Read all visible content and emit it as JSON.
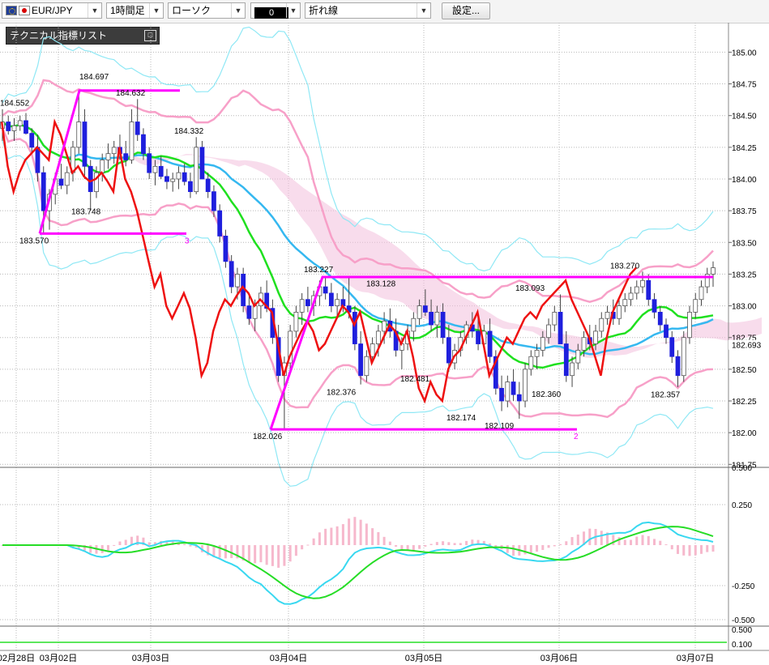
{
  "toolbar": {
    "symbol": "EUR/JPY",
    "timeframe": "1時間足",
    "chart_type": "ローソク",
    "drawing_tool": "0",
    "line_type": "折れ線",
    "settings_button": "設定..."
  },
  "indicator_panel": {
    "title": "テクニカル指標リスト",
    "collapse_icon": "□"
  },
  "colors": {
    "bull": "#ffffff",
    "bear": "#1f1fdd",
    "wick": "#444444",
    "ma_short": "#1fe01f",
    "ma_mid": "#35b8f0",
    "bb_outer": "#8fe8f5",
    "bb_inner": "#f7a0c8",
    "zigzag": "#ff00ff",
    "red_line": "#ee1111",
    "cloud": "#f2bfdc",
    "cloud_blue": "#b8d8f5"
  },
  "chart_data": [
    {
      "type": "candlestick",
      "title": "",
      "price_axis": {
        "ticks": [
          "185.00",
          "184.75",
          "184.50",
          "184.25",
          "184.00",
          "183.75",
          "183.50",
          "183.25",
          "183.00",
          "182.75",
          "182.50",
          "182.25",
          "182.00",
          "181.75"
        ],
        "ylim": [
          181.72,
          185.06
        ],
        "current_price": "182.693"
      },
      "date_labels": [
        "02月28日",
        "03月02日",
        "03月03日",
        "03月04日",
        "03月05日",
        "03月06日",
        "03月07日"
      ],
      "annotations": [
        "184.552",
        "184.697",
        "184.632",
        "184.332",
        "183.748",
        "183.570",
        "183.227",
        "183.128",
        "183.093",
        "183.270",
        "182.376",
        "182.481",
        "182.174",
        "182.109",
        "182.360",
        "182.357",
        "182.026"
      ],
      "zigzag_markers": [
        "3",
        "2"
      ],
      "candles_ohlc": [
        [
          184.4,
          184.55,
          184.3,
          184.45
        ],
        [
          184.45,
          184.5,
          184.35,
          184.38
        ],
        [
          184.38,
          184.48,
          184.3,
          184.42
        ],
        [
          184.42,
          184.5,
          184.38,
          184.46
        ],
        [
          184.46,
          184.52,
          184.35,
          184.36
        ],
        [
          184.36,
          184.4,
          184.2,
          184.25
        ],
        [
          184.25,
          184.35,
          183.98,
          184.05
        ],
        [
          184.05,
          184.1,
          183.57,
          183.75
        ],
        [
          183.75,
          183.92,
          183.6,
          183.88
        ],
        [
          183.88,
          184.05,
          183.8,
          184.0
        ],
        [
          184.0,
          184.12,
          183.92,
          183.95
        ],
        [
          183.95,
          184.1,
          183.88,
          184.05
        ],
        [
          184.05,
          184.3,
          183.98,
          184.25
        ],
        [
          184.25,
          184.69,
          184.2,
          184.45
        ],
        [
          184.45,
          184.55,
          184.0,
          184.1
        ],
        [
          184.1,
          184.15,
          183.75,
          183.9
        ],
        [
          183.9,
          184.1,
          183.85,
          184.05
        ],
        [
          184.05,
          184.2,
          183.98,
          184.15
        ],
        [
          184.15,
          184.28,
          184.08,
          184.2
        ],
        [
          184.2,
          184.3,
          184.12,
          184.25
        ],
        [
          184.25,
          184.35,
          184.15,
          184.2
        ],
        [
          184.2,
          184.3,
          184.1,
          184.15
        ],
        [
          184.15,
          184.55,
          184.12,
          184.45
        ],
        [
          184.45,
          184.63,
          184.3,
          184.35
        ],
        [
          184.35,
          184.4,
          184.15,
          184.2
        ],
        [
          184.2,
          184.25,
          184.0,
          184.05
        ],
        [
          184.05,
          184.15,
          183.95,
          184.1
        ],
        [
          184.1,
          184.18,
          184.0,
          184.02
        ],
        [
          184.02,
          184.08,
          183.92,
          183.98
        ],
        [
          183.98,
          184.05,
          183.9,
          184.0
        ],
        [
          184.0,
          184.1,
          183.92,
          184.05
        ],
        [
          184.05,
          184.12,
          183.95,
          183.98
        ],
        [
          183.98,
          184.05,
          183.85,
          183.9
        ],
        [
          183.9,
          184.33,
          183.88,
          184.25
        ],
        [
          184.25,
          184.3,
          184.0,
          184.0
        ],
        [
          184.0,
          184.05,
          183.85,
          183.9
        ],
        [
          183.9,
          183.95,
          183.7,
          183.75
        ],
        [
          183.75,
          183.8,
          183.5,
          183.55
        ],
        [
          183.55,
          183.6,
          183.3,
          183.35
        ],
        [
          183.35,
          183.4,
          183.1,
          183.15
        ],
        [
          183.15,
          183.3,
          183.05,
          183.25
        ],
        [
          183.25,
          183.3,
          182.95,
          183.0
        ],
        [
          183.0,
          183.1,
          182.85,
          182.9
        ],
        [
          182.9,
          183.05,
          182.8,
          183.0
        ],
        [
          183.0,
          183.15,
          182.9,
          183.1
        ],
        [
          183.1,
          183.2,
          182.95,
          182.98
        ],
        [
          182.98,
          183.05,
          182.7,
          182.75
        ],
        [
          182.75,
          182.85,
          182.4,
          182.45
        ],
        [
          182.45,
          182.6,
          182.03,
          182.55
        ],
        [
          182.55,
          182.85,
          182.5,
          182.8
        ],
        [
          182.8,
          183.0,
          182.75,
          182.95
        ],
        [
          182.95,
          183.1,
          182.85,
          183.05
        ],
        [
          183.05,
          183.15,
          182.95,
          183.0
        ],
        [
          183.0,
          183.12,
          182.92,
          183.08
        ],
        [
          183.08,
          183.2,
          183.0,
          183.15
        ],
        [
          183.15,
          183.23,
          183.05,
          183.1
        ],
        [
          183.1,
          183.18,
          182.95,
          183.0
        ],
        [
          183.0,
          183.1,
          182.9,
          183.05
        ],
        [
          183.05,
          183.15,
          182.95,
          183.0
        ],
        [
          183.0,
          183.23,
          182.9,
          182.95
        ],
        [
          182.95,
          183.0,
          182.65,
          182.7
        ],
        [
          182.7,
          182.8,
          182.38,
          182.45
        ],
        [
          182.45,
          182.65,
          182.4,
          182.6
        ],
        [
          182.6,
          182.75,
          182.55,
          182.7
        ],
        [
          182.7,
          182.85,
          182.6,
          182.8
        ],
        [
          182.8,
          182.95,
          182.7,
          182.88
        ],
        [
          182.88,
          182.98,
          182.75,
          182.8
        ],
        [
          182.8,
          182.9,
          182.6,
          182.65
        ],
        [
          182.65,
          182.75,
          182.5,
          182.7
        ],
        [
          182.7,
          182.85,
          182.65,
          182.8
        ],
        [
          182.8,
          182.95,
          182.72,
          182.9
        ],
        [
          182.9,
          183.05,
          182.85,
          183.0
        ],
        [
          183.0,
          183.13,
          182.92,
          182.95
        ],
        [
          182.95,
          183.05,
          182.8,
          182.85
        ],
        [
          182.85,
          183.0,
          182.75,
          182.95
        ],
        [
          182.95,
          183.02,
          182.7,
          182.75
        ],
        [
          182.75,
          182.85,
          182.48,
          182.55
        ],
        [
          182.55,
          182.7,
          182.5,
          182.65
        ],
        [
          182.65,
          182.8,
          182.6,
          182.75
        ],
        [
          182.75,
          182.88,
          182.7,
          182.85
        ],
        [
          182.85,
          182.95,
          182.75,
          182.8
        ],
        [
          182.8,
          182.9,
          182.65,
          182.7
        ],
        [
          182.7,
          182.85,
          182.65,
          182.8
        ],
        [
          182.8,
          182.9,
          182.55,
          182.6
        ],
        [
          182.6,
          182.65,
          182.3,
          182.35
        ],
        [
          182.35,
          182.45,
          182.17,
          182.25
        ],
        [
          182.25,
          182.45,
          182.2,
          182.4
        ],
        [
          182.4,
          182.5,
          182.25,
          182.3
        ],
        [
          182.3,
          182.4,
          182.11,
          182.25
        ],
        [
          182.25,
          182.55,
          182.2,
          182.5
        ],
        [
          182.5,
          182.65,
          182.45,
          182.6
        ],
        [
          182.6,
          182.7,
          182.5,
          182.65
        ],
        [
          182.65,
          182.8,
          182.6,
          182.75
        ],
        [
          182.75,
          182.9,
          182.7,
          182.85
        ],
        [
          182.85,
          183.0,
          182.8,
          182.95
        ],
        [
          182.95,
          183.09,
          182.9,
          182.7
        ],
        [
          182.7,
          182.8,
          182.4,
          182.45
        ],
        [
          182.45,
          182.6,
          182.36,
          182.55
        ],
        [
          182.55,
          182.7,
          182.5,
          182.65
        ],
        [
          182.65,
          182.8,
          182.6,
          182.75
        ],
        [
          182.75,
          182.85,
          182.65,
          182.7
        ],
        [
          182.7,
          182.85,
          182.65,
          182.8
        ],
        [
          182.8,
          182.95,
          182.75,
          182.9
        ],
        [
          182.9,
          183.0,
          182.85,
          182.95
        ],
        [
          182.95,
          183.05,
          182.85,
          182.9
        ],
        [
          182.9,
          183.05,
          182.85,
          183.0
        ],
        [
          183.0,
          183.1,
          182.95,
          183.05
        ],
        [
          183.05,
          183.15,
          183.0,
          183.1
        ],
        [
          183.1,
          183.2,
          183.05,
          183.15
        ],
        [
          183.15,
          183.27,
          183.1,
          183.2
        ],
        [
          183.2,
          183.25,
          183.0,
          183.05
        ],
        [
          183.05,
          183.1,
          182.9,
          182.95
        ],
        [
          182.95,
          183.0,
          182.8,
          182.85
        ],
        [
          182.85,
          182.9,
          182.7,
          182.75
        ],
        [
          182.75,
          182.8,
          182.55,
          182.6
        ],
        [
          182.6,
          182.65,
          182.36,
          182.45
        ],
        [
          182.45,
          182.8,
          182.4,
          182.75
        ],
        [
          182.75,
          183.0,
          182.7,
          182.95
        ],
        [
          182.95,
          183.1,
          182.9,
          183.05
        ],
        [
          183.05,
          183.2,
          183.0,
          183.15
        ],
        [
          183.15,
          183.3,
          183.1,
          183.25
        ],
        [
          183.25,
          183.35,
          183.15,
          183.3
        ]
      ]
    },
    {
      "type": "line",
      "title": "",
      "axis_ticks": [
        "0.500",
        "0.250",
        "-0.250",
        "-0.500"
      ]
    },
    {
      "type": "line",
      "title": "",
      "axis_ticks": [
        "0.500",
        "0.100"
      ]
    }
  ]
}
